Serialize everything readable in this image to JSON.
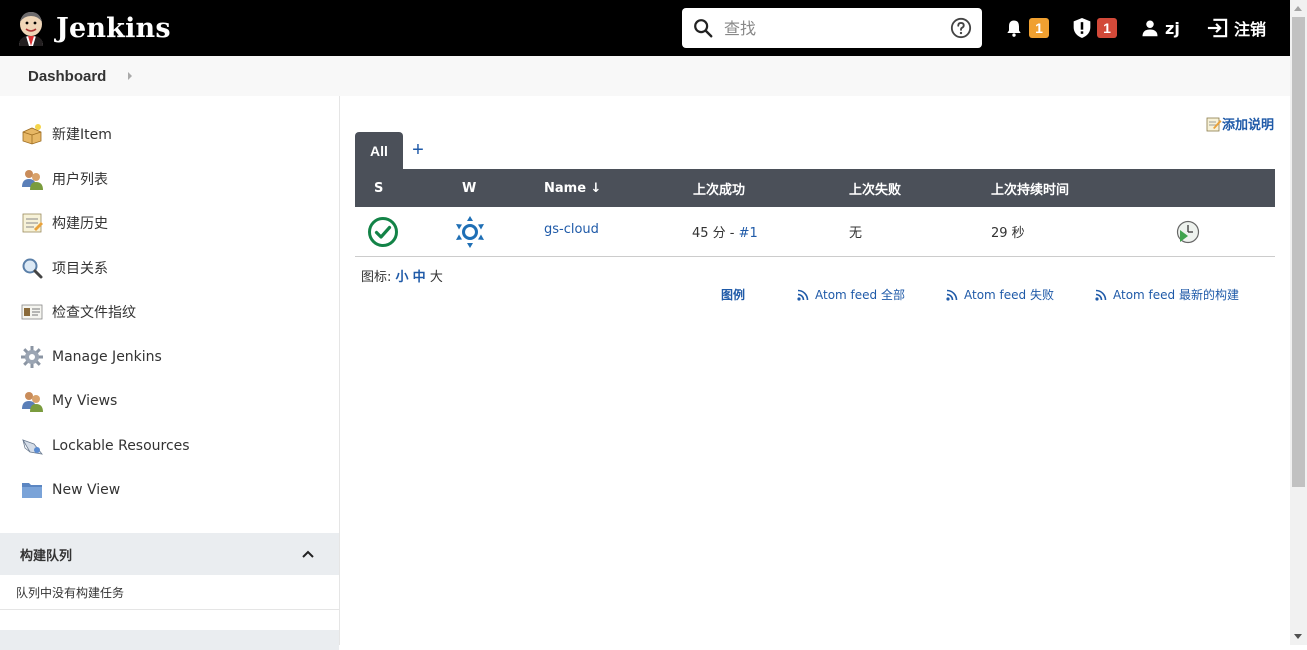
{
  "header": {
    "title": "Jenkins",
    "search_placeholder": "查找",
    "notifications_count": "1",
    "security_count": "1",
    "user": "zj",
    "logout_label": "注销"
  },
  "breadcrumb": {
    "item": "Dashboard"
  },
  "sidebar": {
    "items": [
      {
        "label": "新建Item",
        "icon": "new-item-icon"
      },
      {
        "label": "用户列表",
        "icon": "users-icon"
      },
      {
        "label": "构建历史",
        "icon": "build-history-icon"
      },
      {
        "label": "项目关系",
        "icon": "magnifier-icon"
      },
      {
        "label": "检查文件指纹",
        "icon": "fingerprint-icon"
      },
      {
        "label": "Manage Jenkins",
        "icon": "gear-icon"
      },
      {
        "label": "My Views",
        "icon": "users-icon"
      },
      {
        "label": "Lockable Resources",
        "icon": "lockable-resources-icon"
      },
      {
        "label": "New View",
        "icon": "folder-icon"
      }
    ],
    "build_queue": {
      "title": "构建队列",
      "empty_text": "队列中没有构建任务"
    }
  },
  "main": {
    "add_description": "添加说明",
    "tabs": {
      "all": "All",
      "add": "+"
    },
    "table": {
      "headers": {
        "s": "S",
        "w": "W",
        "name": "Name ↓",
        "last_success": "上次成功",
        "last_failure": "上次失败",
        "last_duration": "上次持续时间"
      },
      "rows": [
        {
          "name": "gs-cloud",
          "last_success_time": "45 分 - ",
          "last_success_build": "#1",
          "last_failure": "无",
          "last_duration": "29 秒"
        }
      ]
    },
    "icon_size": {
      "label": "图标: ",
      "small": "小",
      "medium": "中",
      "large": "大"
    },
    "feeds": {
      "legend": "图例",
      "all": "Atom feed 全部",
      "failed": "Atom feed 失败",
      "latest": "Atom feed 最新的构建"
    }
  },
  "colors": {
    "header_bg": "#000000",
    "table_header_bg": "#4b5059",
    "link": "#1f5aa8",
    "success_green": "#138347",
    "notification_badge": "#f0a030",
    "security_badge": "#d24939"
  }
}
